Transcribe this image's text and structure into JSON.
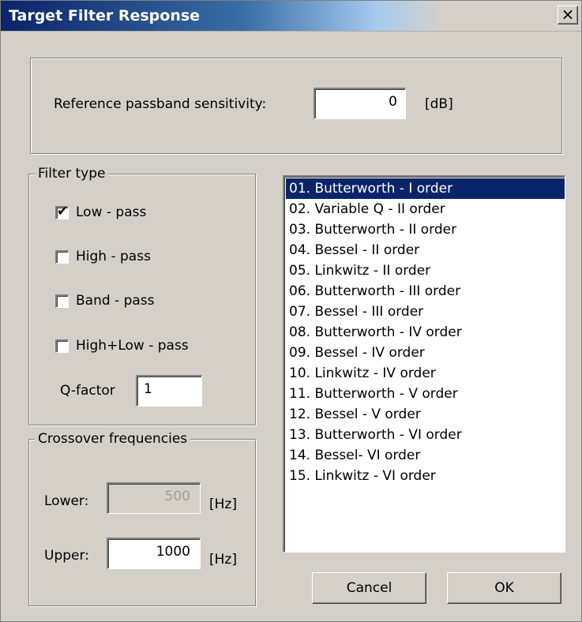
{
  "window": {
    "title": "Target Filter Response",
    "close_glyph": "×"
  },
  "reference": {
    "label": "Reference passband sensitivity:",
    "value": "0",
    "unit": "[dB]"
  },
  "filter_type": {
    "legend": "Filter type",
    "options": [
      {
        "label": "Low - pass",
        "checked": true
      },
      {
        "label": "High - pass",
        "checked": false
      },
      {
        "label": "Band - pass",
        "checked": false
      },
      {
        "label": "High+Low - pass",
        "checked": false
      }
    ],
    "q_label": "Q-factor",
    "q_value": "1"
  },
  "crossover": {
    "legend": "Crossover frequencies",
    "lower_label": "Lower:",
    "lower_value": "500",
    "lower_unit": "[Hz]",
    "upper_label": "Upper:",
    "upper_value": "1000",
    "upper_unit": "[Hz]"
  },
  "filter_list": {
    "selected_index": 0,
    "items": [
      "01. Butterworth - I order",
      "02. Variable Q - II order",
      "03. Butterworth - II order",
      "04. Bessel - II order",
      "05. Linkwitz - II order",
      "06. Butterworth - III order",
      "07. Bessel - III order",
      "08. Butterworth - IV order",
      "09. Bessel - IV order",
      "10. Linkwitz - IV order",
      "11. Butterworth - V order",
      "12. Bessel - V order",
      "13. Butterworth - VI order",
      "14. Bessel- VI order",
      "15. Linkwitz - VI order"
    ]
  },
  "buttons": {
    "cancel": "Cancel",
    "ok": "OK"
  },
  "colors": {
    "dialog_bg": "#d4d0c8",
    "title_bar": "#0a246a",
    "selection": "#0a246a"
  },
  "icons": {
    "close": "close-icon",
    "check": "checkmark-icon"
  }
}
